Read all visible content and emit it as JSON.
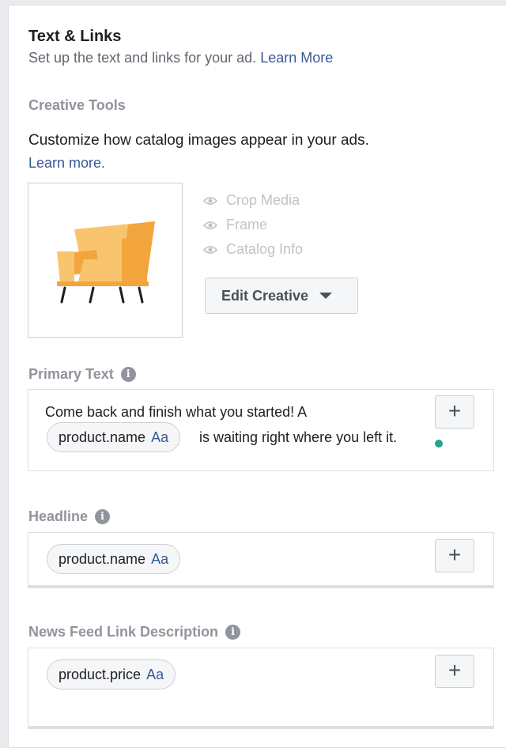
{
  "header": {
    "title": "Text & Links",
    "subtitle": "Set up the text and links for your ad.",
    "learn_more": "Learn More"
  },
  "creative_tools": {
    "label": "Creative Tools",
    "description": "Customize how catalog images appear in your ads.",
    "learn_more": "Learn more.",
    "options": [
      "Crop Media",
      "Frame",
      "Catalog Info"
    ],
    "edit_button": "Edit Creative",
    "icons": {
      "option": "eye-icon",
      "caret": "caret-down-icon",
      "preview": "armchair-illustration"
    }
  },
  "primary_text": {
    "label": "Primary Text",
    "line1": "Come back and finish what you started! A",
    "chip": "product.name",
    "chip_suffix": "Aa",
    "line2": "is waiting right where you left it.",
    "add_button": "+"
  },
  "headline": {
    "label": "Headline",
    "chip": "product.name",
    "chip_suffix": "Aa",
    "add_button": "+"
  },
  "news_feed_link_description": {
    "label": "News Feed Link Description",
    "chip": "product.price",
    "chip_suffix": "Aa",
    "add_button": "+"
  },
  "colors": {
    "link": "#385898",
    "muted": "#90949c",
    "status_dot": "#24a68a",
    "chair_light": "#f9c46e",
    "chair_dark": "#f2a53c"
  }
}
